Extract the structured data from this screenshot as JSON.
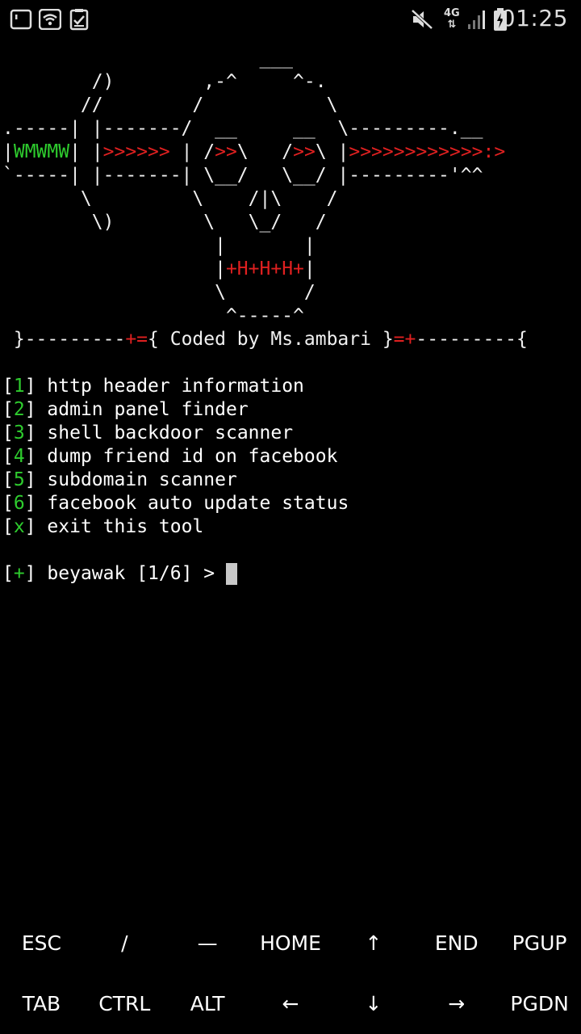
{
  "status_bar": {
    "time": "01:25",
    "network": "4G",
    "icons": [
      "terminal-icon",
      "wifi-icon",
      "clipboard-check-icon",
      "mute-icon",
      "signal-icon",
      "battery-charging-icon"
    ]
  },
  "colors": {
    "background": "#000000",
    "green": "#2ecc2e",
    "red": "#e02020",
    "text": "#f0f0f0",
    "cursor": "#c8c8c8"
  },
  "banner": {
    "lines": [
      [
        {
          "t": "                       ___",
          "c": "w"
        }
      ],
      [
        {
          "t": "        /)        ,-^     ^-.",
          "c": "w"
        }
      ],
      [
        {
          "t": "       //        /           \\",
          "c": "w"
        }
      ],
      [
        {
          "t": ".-----| |-------/  __     __  \\---------.__",
          "c": "w"
        }
      ],
      [
        {
          "t": "|",
          "c": "w"
        },
        {
          "t": "WMWMW",
          "c": "g"
        },
        {
          "t": "| ",
          "c": "w"
        },
        {
          "t": "|",
          "c": "w"
        },
        {
          "t": ">>>>>>",
          "c": "r"
        },
        {
          "t": " | /",
          "c": "w"
        },
        {
          "t": ">>",
          "c": "r"
        },
        {
          "t": "\\   /",
          "c": "w"
        },
        {
          "t": ">>",
          "c": "r"
        },
        {
          "t": "\\ |",
          "c": "w"
        },
        {
          "t": ">>>>>>>>>>>>:>",
          "c": "r"
        }
      ],
      [
        {
          "t": "`-----| |-------| \\__/   \\__/ |---------'^^",
          "c": "w"
        }
      ],
      [
        {
          "t": "       \\         \\    /|\\    /",
          "c": "w"
        }
      ],
      [
        {
          "t": "        \\)        \\   \\_/   /",
          "c": "w"
        }
      ],
      [
        {
          "t": "                   |       |",
          "c": "w"
        }
      ],
      [
        {
          "t": "                   |",
          "c": "w"
        },
        {
          "t": "+H+H+H+",
          "c": "r"
        },
        {
          "t": "|",
          "c": "w"
        }
      ],
      [
        {
          "t": "                   \\       /",
          "c": "w"
        }
      ],
      [
        {
          "t": "                    ^-----^",
          "c": "w"
        }
      ],
      [
        {
          "t": " }---------",
          "c": "w"
        },
        {
          "t": "+=",
          "c": "r"
        },
        {
          "t": "{ Coded by Ms.ambari }",
          "c": "w"
        },
        {
          "t": "=+",
          "c": "r"
        },
        {
          "t": "---------{",
          "c": "w"
        }
      ]
    ]
  },
  "menu": [
    {
      "key": "1",
      "label": "http header information"
    },
    {
      "key": "2",
      "label": "admin panel finder"
    },
    {
      "key": "3",
      "label": "shell backdoor scanner"
    },
    {
      "key": "4",
      "label": "dump friend id on facebook"
    },
    {
      "key": "5",
      "label": "subdomain scanner"
    },
    {
      "key": "6",
      "label": "facebook auto update status"
    },
    {
      "key": "x",
      "label": "exit this tool"
    }
  ],
  "prompt": {
    "marker": "+",
    "text": "beyawak [1/6] > "
  },
  "extra_keys": {
    "row1": [
      "ESC",
      "/",
      "—",
      "HOME",
      "↑",
      "END",
      "PGUP"
    ],
    "row2": [
      "TAB",
      "CTRL",
      "ALT",
      "←",
      "↓",
      "→",
      "PGDN"
    ]
  }
}
